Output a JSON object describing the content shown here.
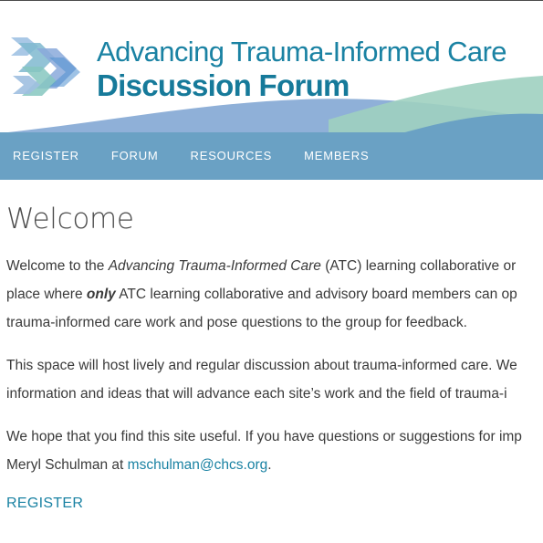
{
  "header": {
    "title_line1": "Advancing Trauma-Informed Care",
    "title_line2": "Discussion Forum",
    "logo_icon": "chevron-arrows-logo-icon",
    "colors": {
      "title": "#1a82a3",
      "wave_blue": "#8fb0d8",
      "wave_teal": "#9fd0c0"
    }
  },
  "nav": {
    "background": "#6aa1c4",
    "items": [
      {
        "label": "REGISTER"
      },
      {
        "label": "FORUM"
      },
      {
        "label": "RESOURCES"
      },
      {
        "label": "MEMBERS"
      }
    ]
  },
  "main": {
    "title": "Welcome",
    "p1": {
      "line1_a": "Welcome to the ",
      "line1_em": "Advancing Trauma-Informed Care",
      "line1_b": " (ATC) learning collaborative or",
      "line2_a": "place where ",
      "line2_strong": "only",
      "line2_b": " ATC learning collaborative and advisory board members can op",
      "line3": "trauma-informed care work and pose questions to the group for feedback."
    },
    "p2": {
      "line1": "This space will host lively and regular discussion about trauma-informed care. We",
      "line2": "information and ideas that will advance each site’s work and the field of trauma-i"
    },
    "p3": {
      "line1": "We hope that you find this site useful. If you have questions or suggestions for imp",
      "line2_a": "Meryl Schulman at ",
      "email": "mschulman@chcs.org",
      "line2_b": "."
    },
    "register_link": "REGISTER",
    "link_color": "#1a82a3"
  }
}
